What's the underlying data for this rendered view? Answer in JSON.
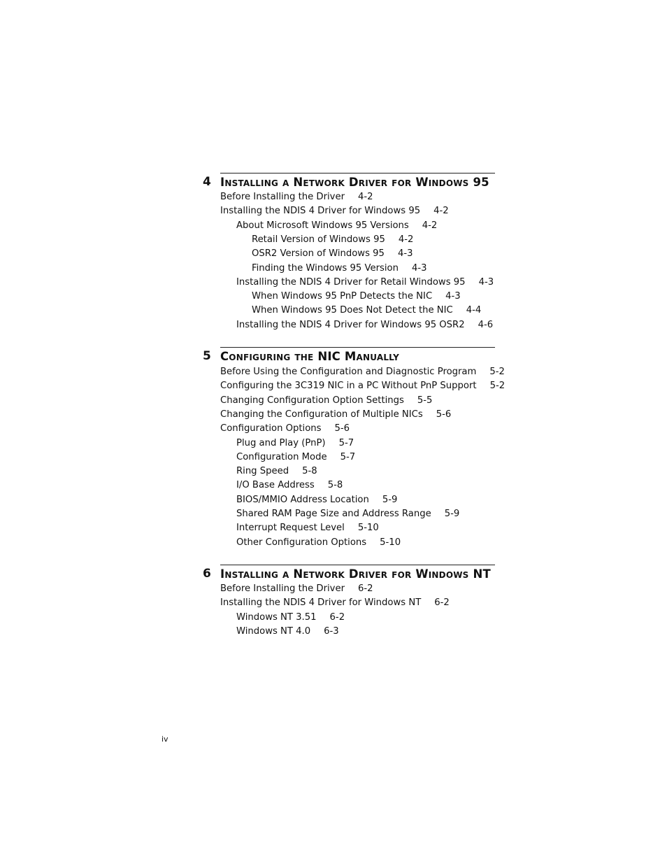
{
  "chapters": [
    {
      "number": "4",
      "title": "Installing a Network Driver for Windows 95",
      "entries": [
        {
          "level": 1,
          "text": "Before Installing the Driver",
          "page": "4-2"
        },
        {
          "level": 1,
          "text": "Installing the NDIS 4 Driver for Windows 95",
          "page": "4-2"
        },
        {
          "level": 2,
          "text": "About Microsoft Windows 95 Versions",
          "page": "4-2"
        },
        {
          "level": 3,
          "text": "Retail Version of Windows 95",
          "page": "4-2"
        },
        {
          "level": 3,
          "text": "OSR2 Version of Windows 95",
          "page": "4-3"
        },
        {
          "level": 3,
          "text": "Finding the Windows 95 Version",
          "page": "4-3"
        },
        {
          "level": 2,
          "text": "Installing the NDIS 4 Driver for Retail Windows 95",
          "page": "4-3"
        },
        {
          "level": 3,
          "text": "When Windows 95 PnP Detects the NIC",
          "page": "4-3"
        },
        {
          "level": 3,
          "text": "When Windows 95 Does Not Detect the NIC",
          "page": "4-4"
        },
        {
          "level": 2,
          "text": "Installing the NDIS 4 Driver for Windows 95 OSR2",
          "page": "4-6"
        }
      ]
    },
    {
      "number": "5",
      "title": "Configuring the NIC Manually",
      "entries": [
        {
          "level": 1,
          "text": "Before Using the Configuration and Diagnostic Program",
          "page": "5-2"
        },
        {
          "level": 1,
          "text": "Configuring the 3C319 NIC in a PC Without PnP Support",
          "page": "5-2"
        },
        {
          "level": 1,
          "text": "Changing Configuration Option Settings",
          "page": "5-5"
        },
        {
          "level": 1,
          "text": "Changing the Configuration of Multiple NICs",
          "page": "5-6"
        },
        {
          "level": 1,
          "text": "Configuration Options",
          "page": "5-6"
        },
        {
          "level": 2,
          "text": "Plug and Play (PnP)",
          "page": "5-7"
        },
        {
          "level": 2,
          "text": "Configuration Mode",
          "page": "5-7"
        },
        {
          "level": 2,
          "text": "Ring Speed",
          "page": "5-8"
        },
        {
          "level": 2,
          "text": "I/O Base Address",
          "page": "5-8"
        },
        {
          "level": 2,
          "text": "BIOS/MMIO Address Location",
          "page": "5-9"
        },
        {
          "level": 2,
          "text": "Shared RAM Page Size and Address Range",
          "page": "5-9"
        },
        {
          "level": 2,
          "text": "Interrupt Request Level",
          "page": "5-10"
        },
        {
          "level": 2,
          "text": "Other Configuration Options",
          "page": "5-10"
        }
      ]
    },
    {
      "number": "6",
      "title": "Installing a Network Driver for Windows NT",
      "entries": [
        {
          "level": 1,
          "text": "Before Installing the Driver",
          "page": "6-2"
        },
        {
          "level": 1,
          "text": "Installing the NDIS 4 Driver for Windows NT",
          "page": "6-2"
        },
        {
          "level": 2,
          "text": "Windows NT 3.51",
          "page": "6-2"
        },
        {
          "level": 2,
          "text": "Windows NT 4.0",
          "page": "6-3"
        }
      ]
    }
  ],
  "folio": "iv"
}
